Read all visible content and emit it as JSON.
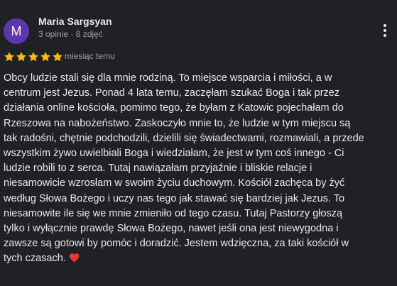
{
  "review": {
    "author": {
      "initial": "M",
      "name": "Maria Sargsyan",
      "meta": "3 opinie · 8 zdjęć",
      "avatar_color": "#5e35b1"
    },
    "rating": {
      "value": 5,
      "max": 5,
      "star_color": "#fbbc04"
    },
    "date": "miesiąc temu",
    "more_icon": "more-vert-icon",
    "text_lines": [
      "Obcy ludzie stali się dla mnie rodziną. To miejsce wsparcia i miłości, a w",
      "centrum jest Jezus. Ponad 4 lata temu, zaczęłam szukać Boga i tak przez",
      "działania online kościoła, pomimo tego, że byłam z Katowic pojechałam do",
      "Rzeszowa na nabożeństwo. Zaskoczyło mnie to, że ludzie w tym miejscu są",
      "tak radośni, chętnie podchodzili, dzielili się świadectwami, rozmawiali, a przede",
      "wszystkim żywo uwielbiali Boga i wiedziałam, że jest w tym coś innego - Ci",
      "ludzie robili to z serca. Tutaj nawiązałam przyjaźnie i bliskie relacje i",
      "niesamowicie wzrosłam w swoim życiu duchowym. Kościół zachęca by żyć",
      "według Słowa Bożego i uczy nas tego jak stawać się bardziej jak Jezus. To",
      "niesamowite ile się we mnie zmieniło od tego czasu. Tutaj Pastorzy głoszą",
      "tylko i wyłącznie prawdę Słowa Bożego, nawet jeśli ona jest niewygodna i",
      "zawsze są gotowi by pomóc i doradzić. Jestem wdzięczna, za taki kościół w",
      "tych czasach."
    ],
    "emoji": "heart-icon",
    "emoji_color": "#e53935"
  }
}
